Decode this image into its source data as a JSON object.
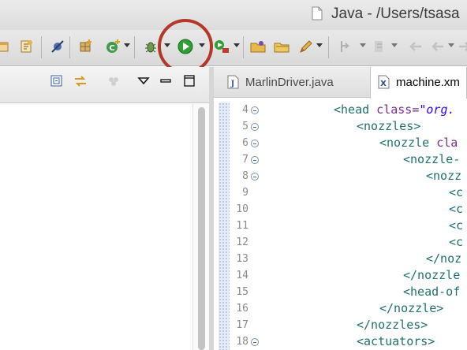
{
  "window": {
    "title": "Java - /Users/tsasa"
  },
  "toolbar": {
    "buttons": [
      {
        "name": "open-type-icon"
      },
      {
        "name": "open-resource-icon"
      },
      {
        "name": "skip-breakpoints-icon"
      },
      {
        "name": "new-package-icon"
      },
      {
        "name": "new-class-icon"
      },
      {
        "name": "debug-icon"
      },
      {
        "name": "run-icon"
      },
      {
        "name": "external-tools-icon"
      },
      {
        "name": "open-folder-icon"
      },
      {
        "name": "open-project-icon"
      },
      {
        "name": "edit-icon"
      },
      {
        "name": "next-annotation-icon"
      },
      {
        "name": "previous-annotation-icon"
      },
      {
        "name": "back-icon"
      },
      {
        "name": "forward-icon"
      }
    ],
    "highlight_color": "#b4372a",
    "run_color": "#2f9e34"
  },
  "left_view": {
    "toolbar_icons": [
      "collapse-all-icon",
      "link-with-editor-icon",
      "focus-icon",
      "view-menu-icon",
      "minimize-icon",
      "maximize-icon"
    ]
  },
  "editor": {
    "tabs": [
      {
        "label": "MarlinDriver.java",
        "icon": "java-file-icon",
        "active": false
      },
      {
        "label": "machine.xm",
        "icon": "xml-file-icon",
        "active": true
      }
    ],
    "lines": [
      {
        "num": "4",
        "fold": true,
        "tag": "<head",
        "attr": " class=",
        "val": "\"org.",
        "close": ""
      },
      {
        "num": "5",
        "fold": true,
        "tag": "<nozzles>",
        "attr": "",
        "val": "",
        "close": ""
      },
      {
        "num": "6",
        "fold": true,
        "tag": "<nozzle",
        "attr": " cla",
        "val": "",
        "close": ""
      },
      {
        "num": "7",
        "fold": true,
        "tag": "<nozzle-",
        "attr": "",
        "val": "",
        "close": ""
      },
      {
        "num": "8",
        "fold": true,
        "tag": "<nozz",
        "attr": "",
        "val": "",
        "close": ""
      },
      {
        "num": "9",
        "fold": false,
        "tag": "<c",
        "attr": "",
        "val": "",
        "close": ""
      },
      {
        "num": "10",
        "fold": false,
        "tag": "<c",
        "attr": "",
        "val": "",
        "close": ""
      },
      {
        "num": "11",
        "fold": false,
        "tag": "<c",
        "attr": "",
        "val": "",
        "close": ""
      },
      {
        "num": "12",
        "fold": false,
        "tag": "<c",
        "attr": "",
        "val": "",
        "close": ""
      },
      {
        "num": "13",
        "fold": false,
        "tag": "</noz",
        "attr": "",
        "val": "",
        "close": ""
      },
      {
        "num": "14",
        "fold": false,
        "tag": "</nozzle",
        "attr": "",
        "val": "",
        "close": ""
      },
      {
        "num": "15",
        "fold": false,
        "tag": "<head-of",
        "attr": "",
        "val": "",
        "close": ""
      },
      {
        "num": "16",
        "fold": false,
        "tag": "</nozzle>",
        "attr": "",
        "val": "",
        "close": ""
      },
      {
        "num": "17",
        "fold": false,
        "tag": "</nozzles>",
        "attr": "",
        "val": "",
        "close": ""
      },
      {
        "num": "18",
        "fold": true,
        "tag": "<actuators>",
        "attr": "",
        "val": "",
        "close": ""
      }
    ],
    "colors": {
      "tag": "#20716c",
      "attr": "#7a2c8f",
      "val": "#2a00ff"
    }
  }
}
